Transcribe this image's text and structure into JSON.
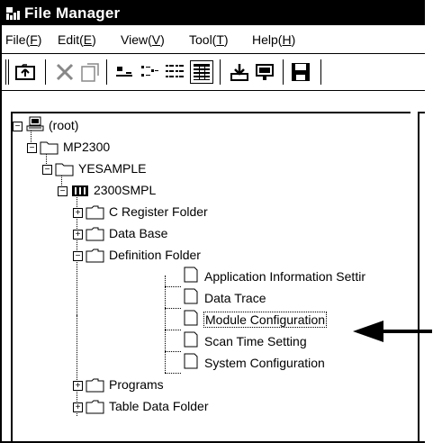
{
  "window": {
    "title": "File Manager"
  },
  "menu": [
    {
      "label": "File(",
      "key": "F",
      "end": ")"
    },
    {
      "label": "Edit(",
      "key": "E",
      "end": ")"
    },
    {
      "label": "View(",
      "key": "V",
      "end": ")"
    },
    {
      "label": "Tool(",
      "key": "T",
      "end": ")"
    },
    {
      "label": "Help(",
      "key": "H",
      "end": ")"
    }
  ],
  "toolbar_icons": [
    "up-folder-icon",
    "delete-icon",
    "properties-icon",
    "large-icons-icon",
    "small-icons-icon",
    "list-view-icon",
    "details-view-icon",
    "download-icon",
    "transfer-icon",
    "save-icon"
  ],
  "tree": {
    "root": "(root)",
    "controller": "MP2300",
    "application": "YESAMPLE",
    "program": "2300SMPL",
    "folders": [
      "C Register Folder",
      "Data Base",
      "Definition Folder"
    ],
    "definition_items": [
      "Application Information Settir",
      "Data Trace",
      "Module Configuration",
      "Scan Time Setting",
      "System Configuration"
    ],
    "after_folders": [
      "Programs",
      "Table Data Folder"
    ],
    "selected": "Module Configuration"
  }
}
